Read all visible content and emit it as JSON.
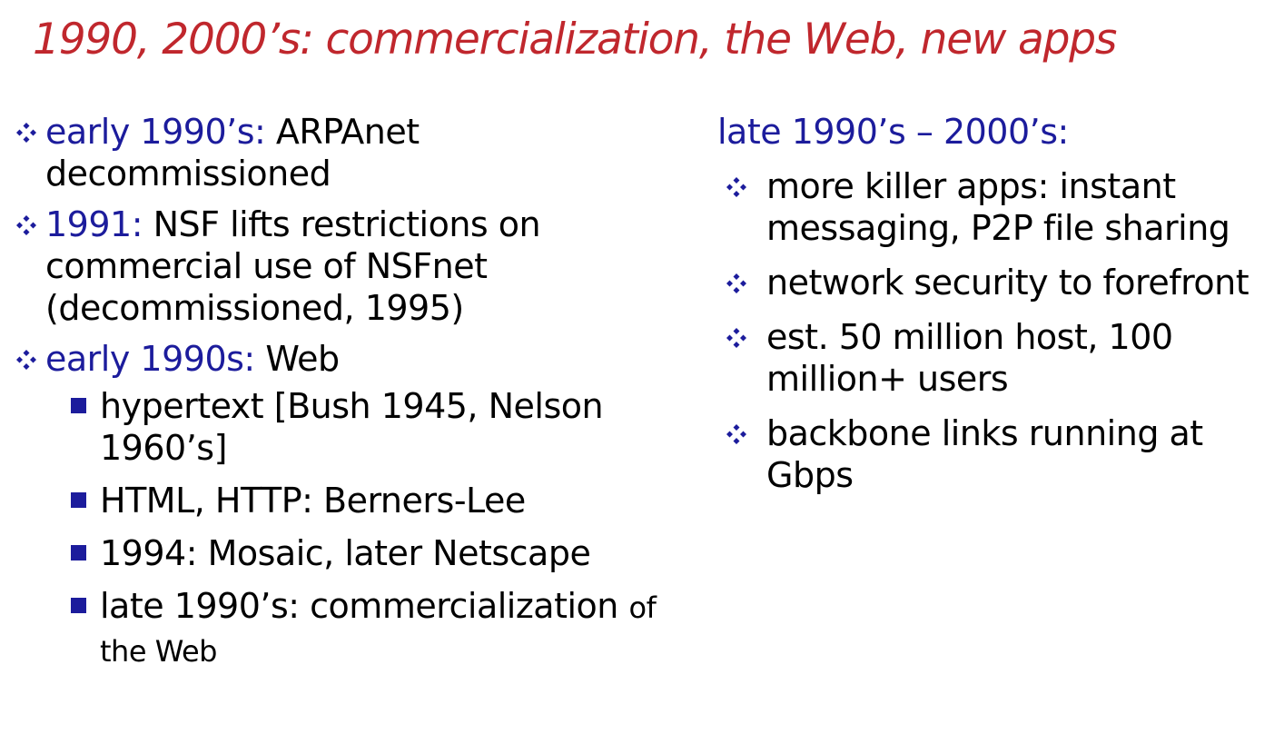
{
  "title": "1990, 2000’s: commercialization, the Web, new apps",
  "colors": {
    "title": "#c0272d",
    "accent": "#1c1c9c",
    "text": "#000000"
  },
  "left": {
    "items": [
      {
        "key": "early 1990’s:",
        "text": "ARPAnet decommissioned"
      },
      {
        "key": "1991:",
        "text": "NSF lifts restrictions on commercial use of NSFnet (decommissioned, 1995)"
      },
      {
        "key": "early 1990s:",
        "text": "Web"
      }
    ],
    "subitems": [
      {
        "text": "hypertext [Bush 1945, Nelson 1960’s]"
      },
      {
        "text": "HTML, HTTP: Berners-Lee"
      },
      {
        "text": "1994: Mosaic, later Netscape"
      },
      {
        "text": "late 1990’s: commercialization",
        "small": "of the Web"
      }
    ]
  },
  "right": {
    "heading": "late 1990’s – 2000’s:",
    "items": [
      "more killer apps: instant messaging, P2P file sharing",
      "network security to forefront",
      "est. 50 million host, 100 million+ users",
      "backbone links running at Gbps"
    ]
  }
}
